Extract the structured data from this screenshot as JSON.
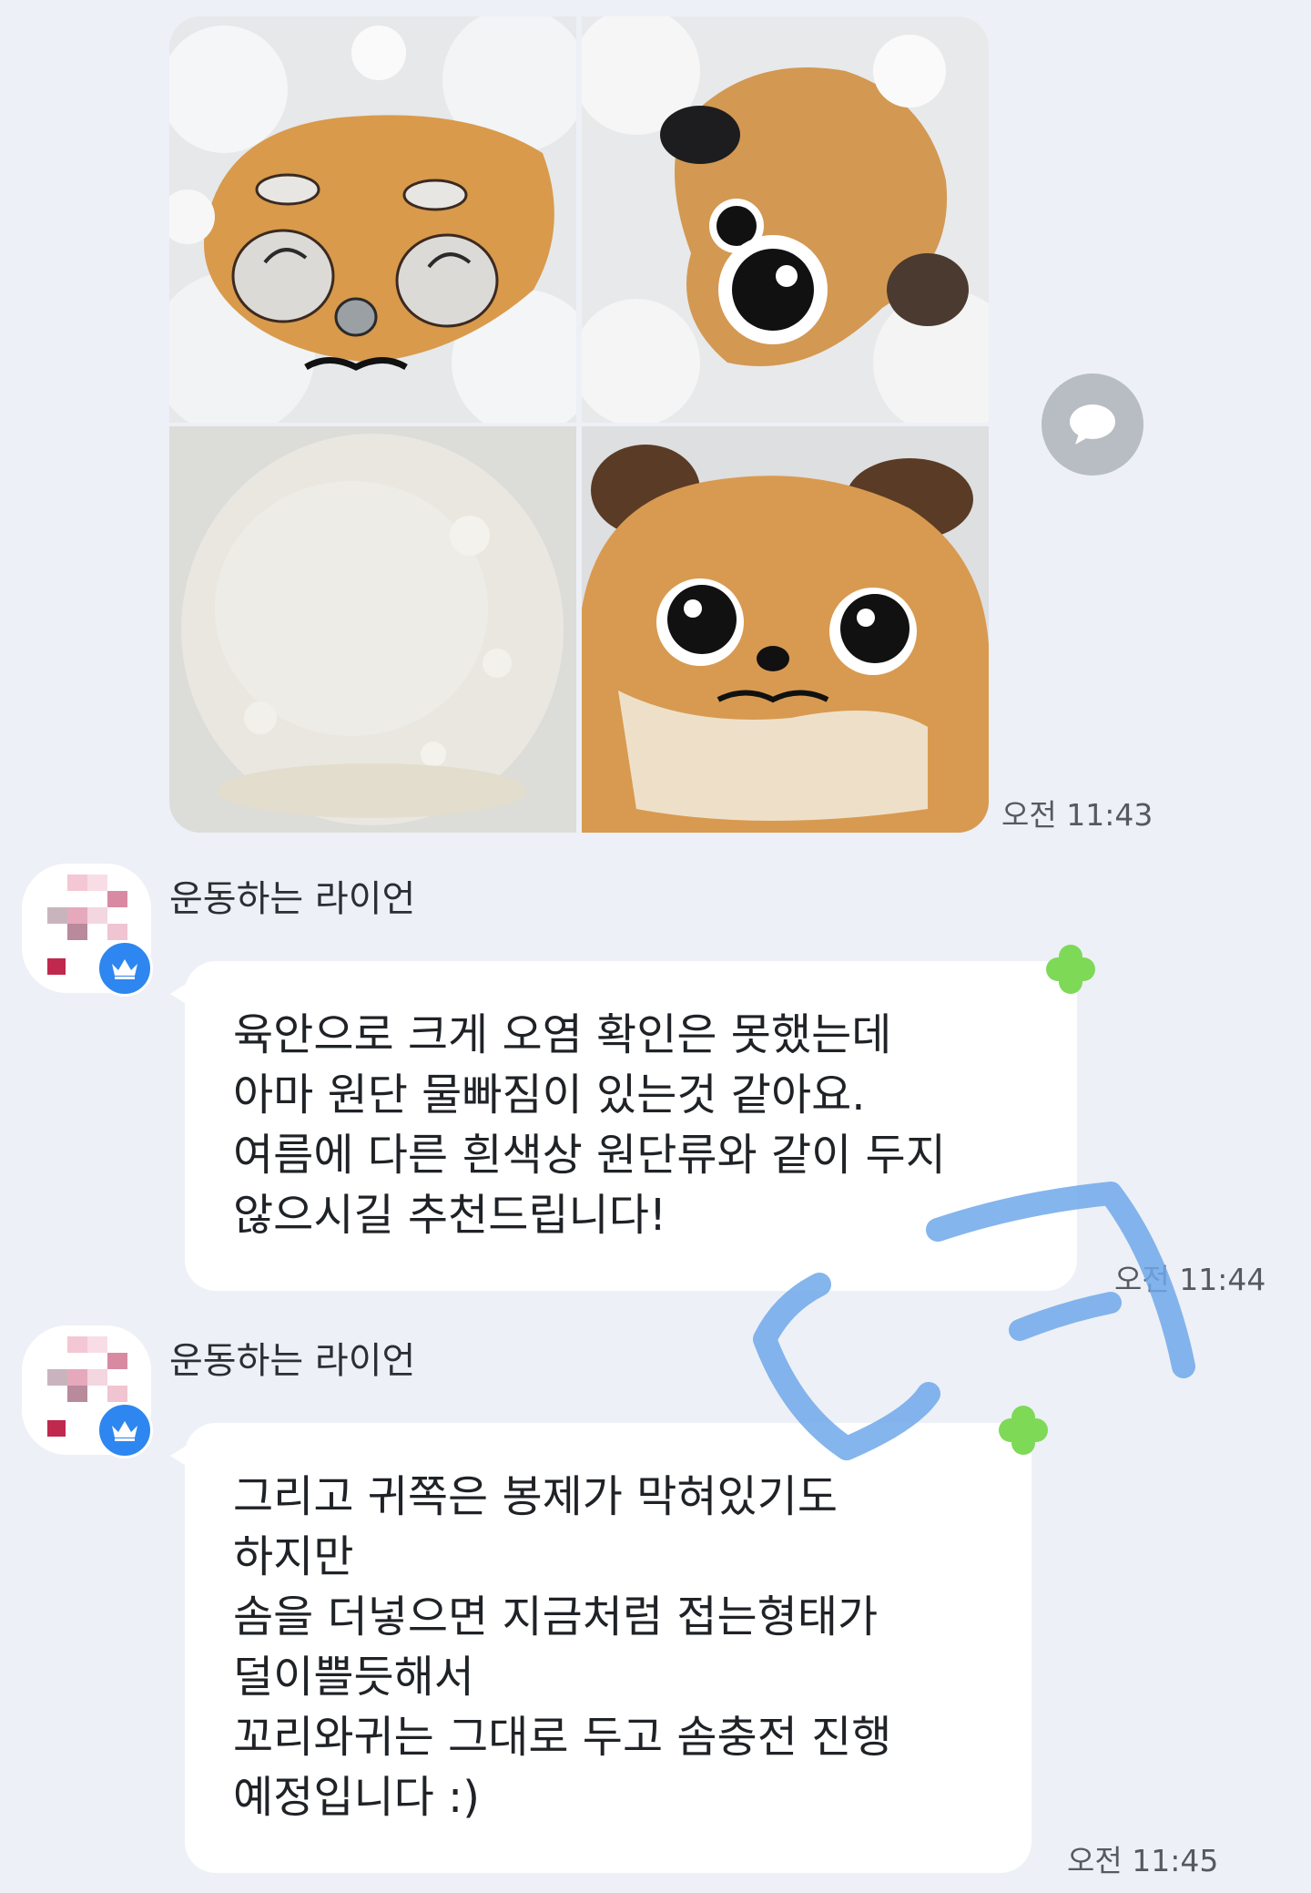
{
  "photos": [
    {
      "label": "sudsy-fox-face-photo"
    },
    {
      "label": "sudsy-dog-face-photo"
    },
    {
      "label": "soapy-water-photo"
    },
    {
      "label": "rinsed-dog-hood-photo"
    }
  ],
  "photo_message": {
    "timestamp": "오전 11:43",
    "share_icon": "speech-bubble-icon"
  },
  "messages": [
    {
      "sender": "운동하는 라이언",
      "badge_icon": "crown-icon",
      "lines": [
        "육안으로 크게 오염 확인은 못했는데",
        "아마 원단 물빠짐이 있는것 같아요.",
        "여름에 다른 흰색상 원단류와 같이 두지",
        "않으시길 추천드립니다!"
      ],
      "timestamp": "오전 11:44",
      "reaction_icon": "clover-icon"
    },
    {
      "sender": "운동하는 라이언",
      "badge_icon": "crown-icon",
      "lines": [
        "그리고 귀쪽은 봉제가 막혀있기도",
        "하지만",
        "솜을 더넣으면 지금처럼 접는형태가",
        "덜이쁠듯해서",
        "꼬리와귀는 그대로 두고 솜충전 진행",
        "예정입니다 :)"
      ],
      "timestamp": "오전 11:45",
      "reaction_icon": "clover-icon"
    }
  ],
  "colors": {
    "background": "#edf0f6",
    "bubble": "#ffffff",
    "crown_badge": "#2e86f0",
    "clover": "#7ed957",
    "handwriting": "#6fa8ea"
  }
}
